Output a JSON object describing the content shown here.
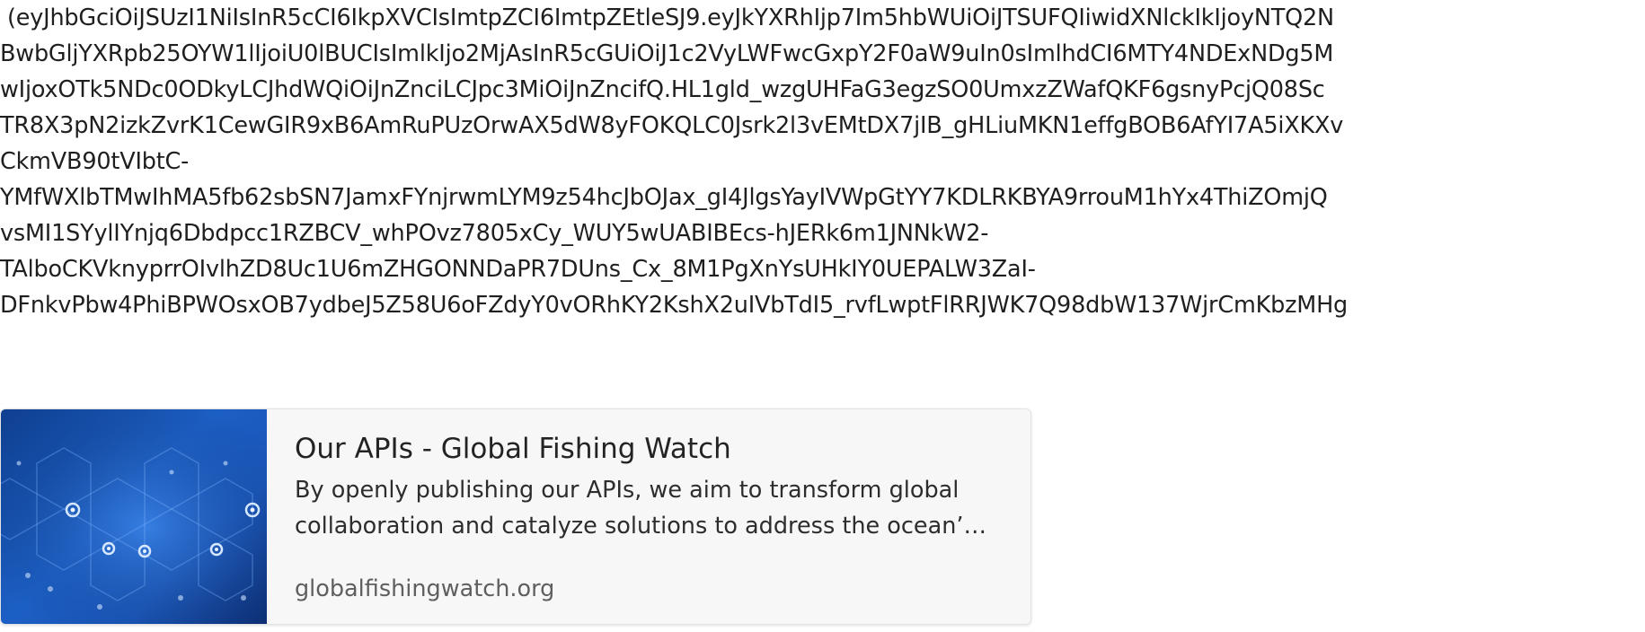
{
  "token_lines": [
    "(eyJhbGciOiJSUzI1NiIsInR5cCI6IkpXVCIsImtpZCI6ImtpZEtleSJ9.eyJkYXRhIjp7Im5hbWUiOiJTSUFQIiwidXNlckIkIjoyNTQ2N",
    "BwbGljYXRpb25OYW1lIjoiU0lBUCIsImlkIjo2MjAsInR5cGUiOiJ1c2VyLWFwcGxpY2F0aW9uIn0sImlhdCI6MTY4NDExNDg5M",
    "wIjoxOTk5NDc0ODkyLCJhdWQiOiJnZnciLCJpc3MiOiJnZncifQ.HL1gld_wzgUHFaG3egzSO0UmxzZWafQKF6gsnyPcjQ08Sc",
    "TR8X3pN2izkZvrK1CewGIR9xB6AmRuPUzOrwAX5dW8yFOKQLC0Jsrk2l3vEMtDX7jIB_gHLiuMKN1effgBOB6AfYI7A5iXKXv",
    "CkmVB90tVIbtC-",
    "YMfWXlbTMwIhMA5fb62sbSN7JamxFYnjrwmLYM9z54hcJbOJax_gI4JlgsYayIVWpGtYY7KDLRKBYA9rrouM1hYx4ThiZOmjQ",
    "vsMI1SYylIYnjq6Dbdpcc1RZBCV_whPOvz7805xCy_WUY5wUABIBEcs-hJERk6m1JNNkW2-",
    "TAlboCKVknyprrOIvlhZD8Uc1U6mZHGONNDaPR7DUns_Cx_8M1PgXnYsUHkIY0UEPALW3ZaI-",
    "DFnkvPbw4PhiBPWOsxOB7ydbeJ5Z58U6oFZdyY0vORhKY2KshX2uIVbTdI5_rvfLwptFlRRJWK7Q98dbW137WjrCmKbzMHg"
  ],
  "link_preview": {
    "title": "Our APIs - Global Fishing Watch",
    "description": "By openly publishing our APIs, we aim to transform global collaboration and catalyze solutions to address the ocean’…",
    "domain": "globalfishingwatch.org",
    "thumbnail_icon": "hexagon-gears-icon"
  }
}
